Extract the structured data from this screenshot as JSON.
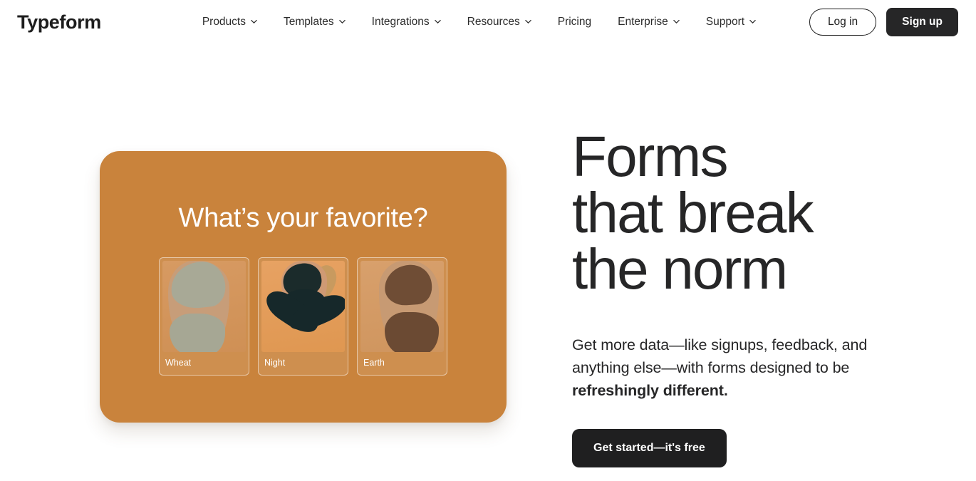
{
  "header": {
    "logo": "Typeform",
    "nav": [
      {
        "label": "Products",
        "has_dropdown": true,
        "icon": "chevron-down-icon"
      },
      {
        "label": "Templates",
        "has_dropdown": true,
        "icon": "chevron-down-icon"
      },
      {
        "label": "Integrations",
        "has_dropdown": true,
        "icon": "chevron-down-icon"
      },
      {
        "label": "Resources",
        "has_dropdown": true,
        "icon": "chevron-down-icon"
      },
      {
        "label": "Pricing",
        "has_dropdown": false,
        "icon": ""
      },
      {
        "label": "Enterprise",
        "has_dropdown": true,
        "icon": "chevron-down-icon"
      },
      {
        "label": "Support",
        "has_dropdown": true,
        "icon": "chevron-down-icon"
      }
    ],
    "login_label": "Log in",
    "signup_label": "Sign up"
  },
  "hero": {
    "headline": "Forms\nthat break\nthe norm",
    "subcopy_prefix": "Get more data—like signups, feedback, and anything else—with forms designed to be ",
    "subcopy_bold": "refreshingly different.",
    "cta_label": "Get started—it's free"
  },
  "preview": {
    "question": "What’s your favorite?",
    "choices": [
      {
        "label": "Wheat",
        "photo": "woman-in-sage-green-activewear-photo"
      },
      {
        "label": "Night",
        "photo": "woman-in-black-activewear-lunging-photo"
      },
      {
        "label": "Earth",
        "photo": "woman-in-brown-activewear-photo"
      }
    ]
  },
  "colors": {
    "page_background": "#ffffff",
    "text_primary": "#262627",
    "card_orange": "#c9833c",
    "button_dark": "#1f1f20",
    "signup_dark": "#262627",
    "choice_border": "#ffffff"
  }
}
